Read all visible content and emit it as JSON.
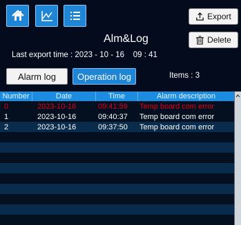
{
  "nav": {
    "home_icon": "home-icon",
    "trend_icon": "line-chart-icon",
    "list_icon": "list-icon"
  },
  "actions": {
    "export_label": "Export",
    "delete_label": "Delete"
  },
  "title": "Alm&Log",
  "export_time": "Last export time : 2023 - 10 - 16    09 : 41",
  "tabs": {
    "alarm_log": "Alarm log",
    "operation_log": "Operation log"
  },
  "items_count": "Items : 3",
  "table": {
    "headers": [
      "Number",
      "Date",
      "Time",
      "Alarm description"
    ],
    "rows": [
      {
        "number": "0",
        "date": "2023-10-16",
        "time": "09:41:59",
        "desc": "Temp board com error"
      },
      {
        "number": "1",
        "date": "2023-10-16",
        "time": "09:40:37",
        "desc": "Temp board com error"
      },
      {
        "number": "2",
        "date": "2023-10-16",
        "time": "09:37:50",
        "desc": "Temp board com error"
      }
    ]
  },
  "colors": {
    "accent": "#1f86d6",
    "alarm_text": "#e0001a",
    "background": "#030b1c"
  }
}
